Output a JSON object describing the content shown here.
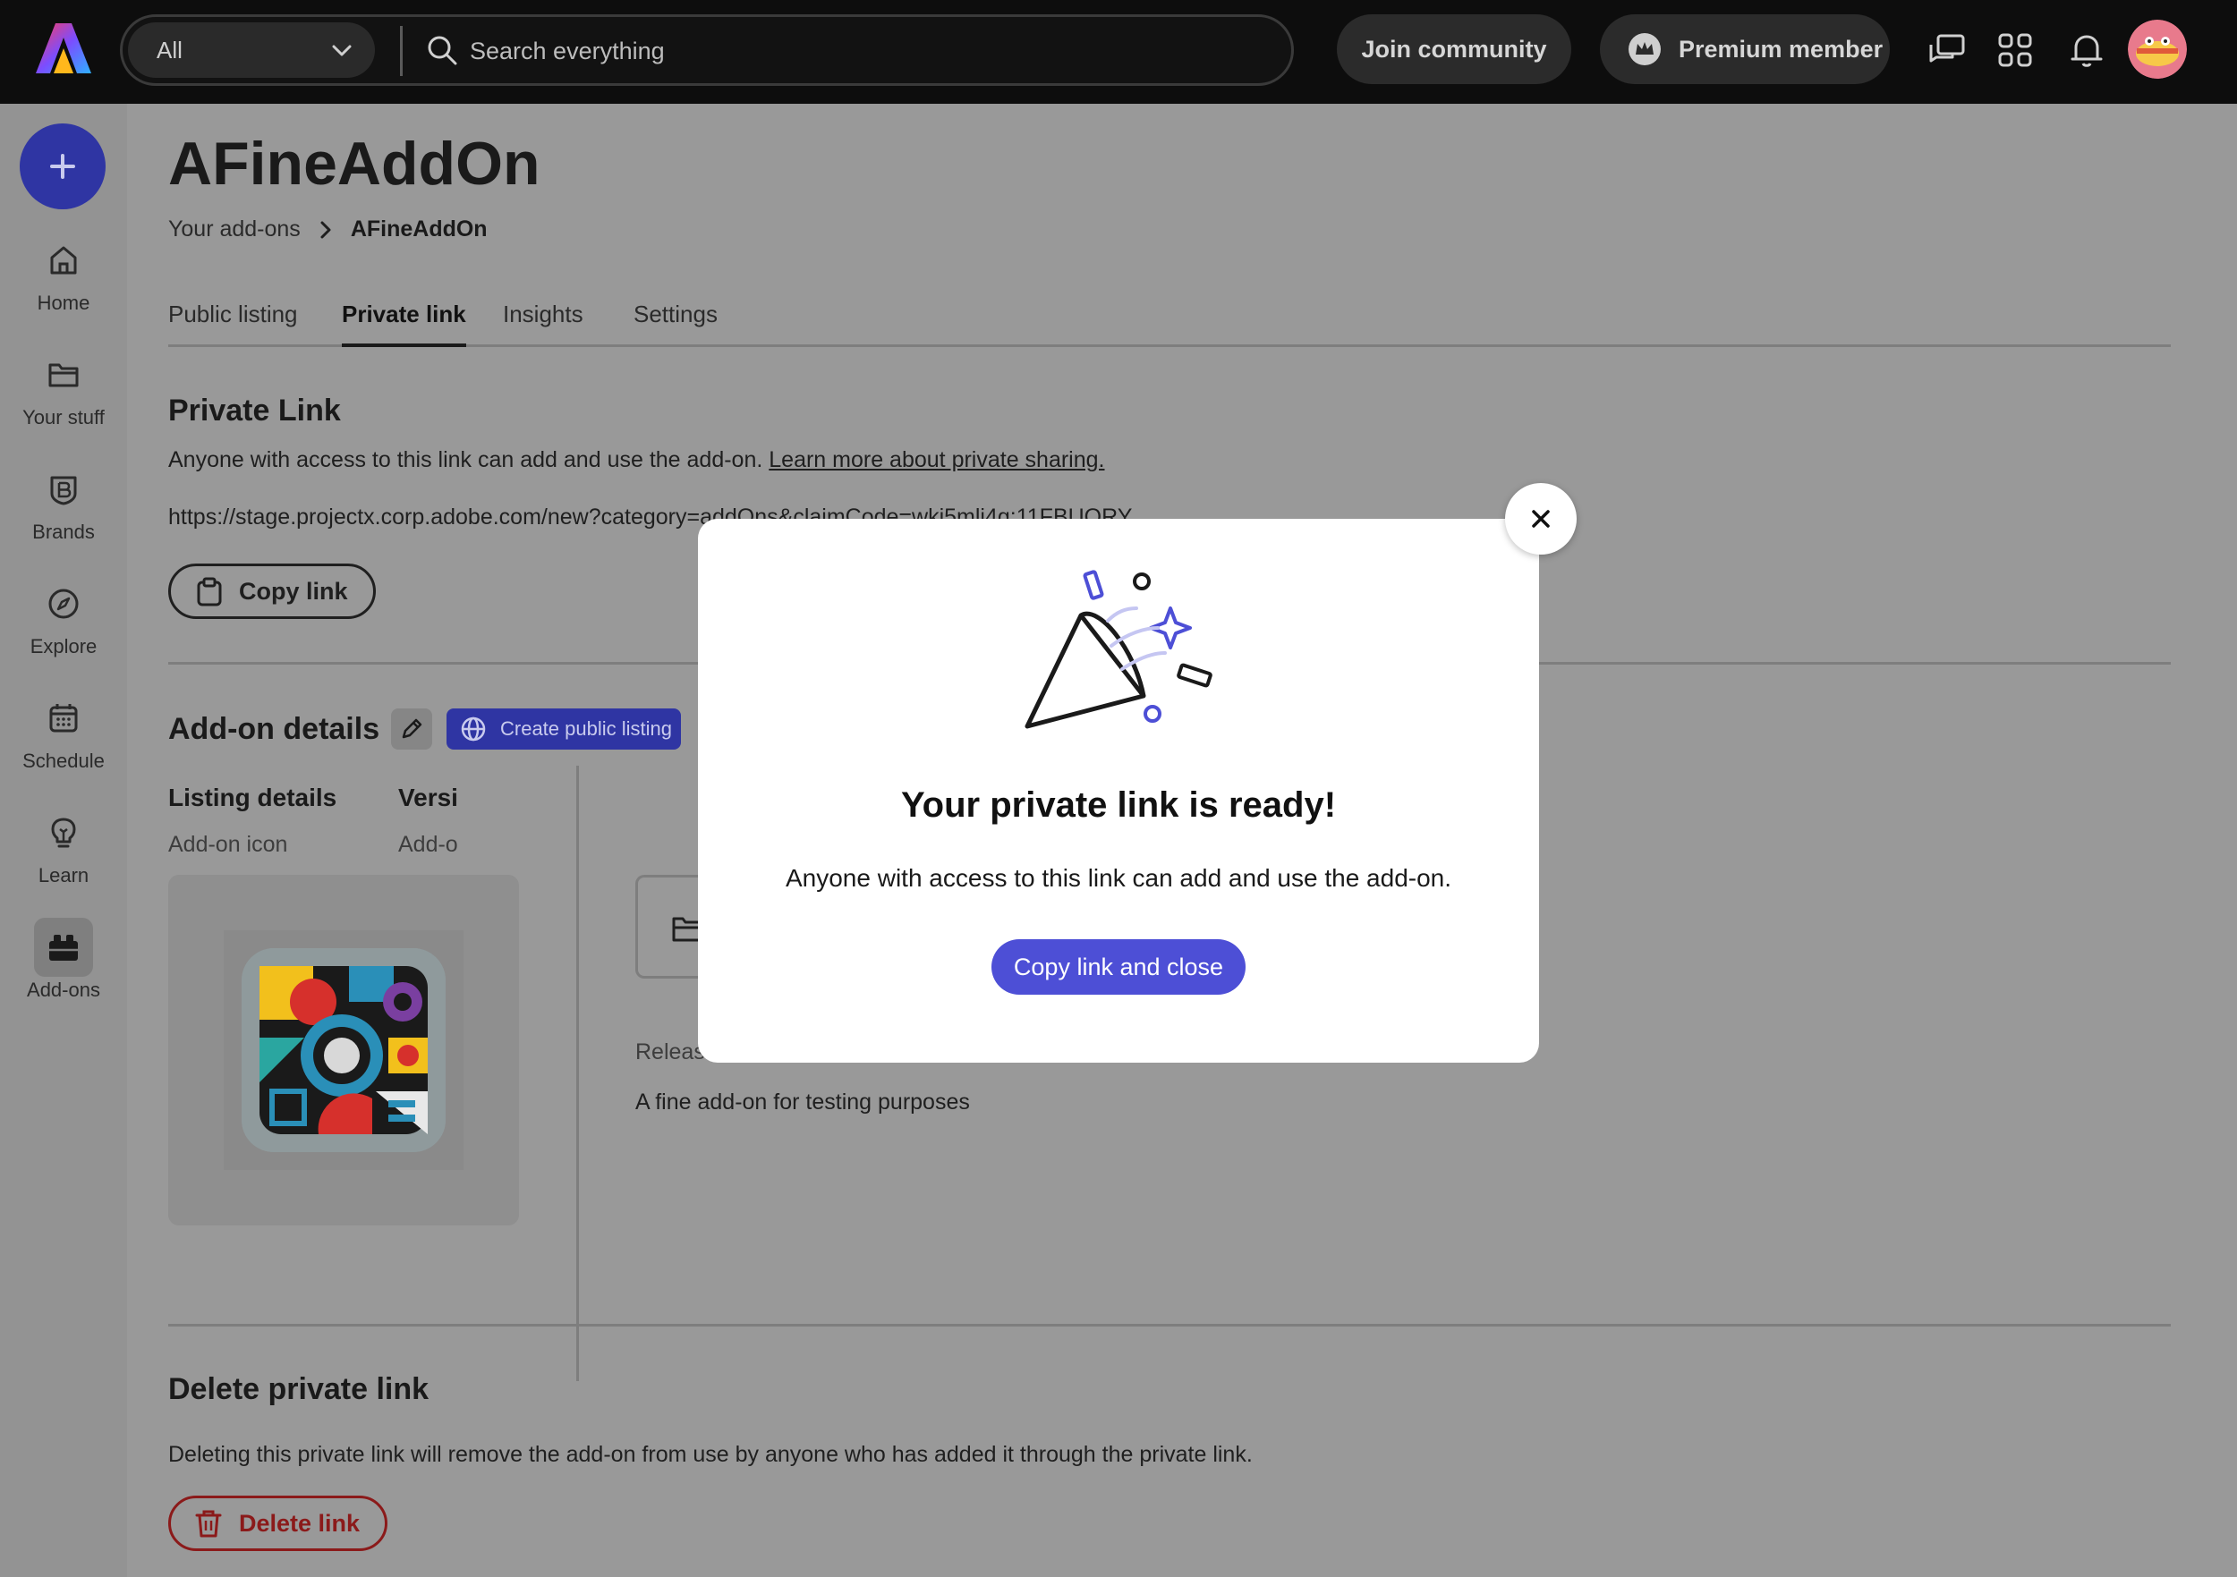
{
  "topbar": {
    "scope_label": "All",
    "search_placeholder": "Search everything",
    "join_label": "Join community",
    "premium_label": "Premium member"
  },
  "sidebar": {
    "items": [
      {
        "label": "Home",
        "icon": "home-icon"
      },
      {
        "label": "Your stuff",
        "icon": "folder-icon"
      },
      {
        "label": "Brands",
        "icon": "brand-icon"
      },
      {
        "label": "Explore",
        "icon": "compass-icon"
      },
      {
        "label": "Schedule",
        "icon": "calendar-icon"
      },
      {
        "label": "Learn",
        "icon": "lightbulb-icon"
      },
      {
        "label": "Add-ons",
        "icon": "addons-icon"
      }
    ]
  },
  "page": {
    "title": "AFineAddOn",
    "breadcrumb_parent": "Your add-ons",
    "breadcrumb_current": "AFineAddOn",
    "tabs": [
      "Public listing",
      "Private link",
      "Insights",
      "Settings"
    ],
    "active_tab": "Private link"
  },
  "private_link": {
    "heading": "Private Link",
    "description": "Anyone with access to this link can add and use the add-on.",
    "learn_more": "Learn more about private sharing.",
    "url": "https://stage.projectx.corp.adobe.com/new?category=addOns&claimCode=wkj5mli4g:11FBUQRY",
    "copy_label": "Copy link"
  },
  "details": {
    "heading": "Add-on details",
    "create_listing": "Create public listing",
    "listing_heading": "Listing details",
    "icon_label": "Add-on icon",
    "version_heading_fragment": "Versi",
    "version_sub_fragment": "Add-o",
    "release_fragment": "Releas",
    "description": "A fine add-on for testing purposes"
  },
  "delete": {
    "heading": "Delete private link",
    "description": "Deleting this private link will remove the add-on from use by anyone who has added it through the private link.",
    "button": "Delete link"
  },
  "modal": {
    "title": "Your private link is ready!",
    "text": "Anyone with access to this link can add and use the add-on.",
    "cta": "Copy link and close"
  },
  "colors": {
    "accent": "#4d4fd6",
    "danger": "#8b1a1a",
    "topbar": "#0d0d0d"
  }
}
